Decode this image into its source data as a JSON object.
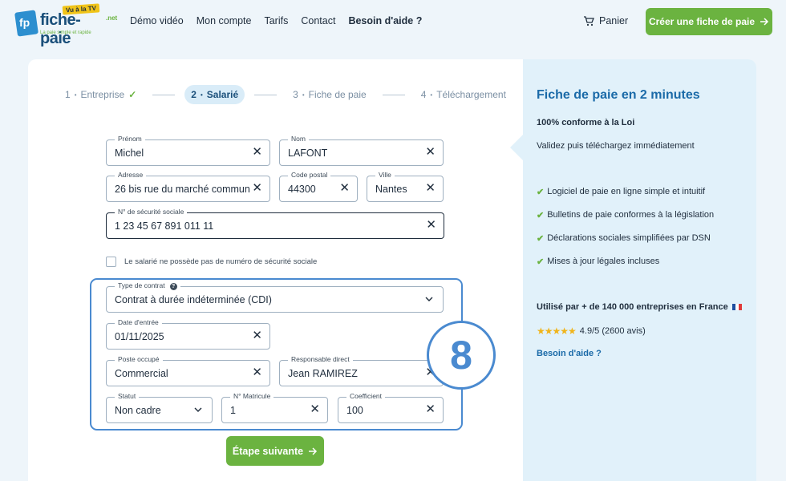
{
  "header": {
    "logo_tv": "Vu à la TV",
    "logo_fp": "fp",
    "logo_name": "fiche-paie",
    "logo_net": ".net",
    "logo_tagline": "La paie simple et rapide",
    "nav": [
      "Démo vidéo",
      "Mon compte",
      "Tarifs",
      "Contact",
      "Besoin d'aide ?"
    ],
    "cart_label": "Panier",
    "cta_label": "Créer une fiche de paie"
  },
  "steps": [
    {
      "num": "1",
      "label": "Entreprise"
    },
    {
      "num": "2",
      "label": "Salarié"
    },
    {
      "num": "3",
      "label": "Fiche de paie"
    },
    {
      "num": "4",
      "label": "Téléchargement"
    }
  ],
  "form": {
    "prenom": {
      "label": "Prénom",
      "value": "Michel"
    },
    "nom": {
      "label": "Nom",
      "value": "LAFONT"
    },
    "adresse": {
      "label": "Adresse",
      "value": "26 bis rue du marché commun"
    },
    "code_postal": {
      "label": "Code postal",
      "value": "44300"
    },
    "ville": {
      "label": "Ville",
      "value": "Nantes"
    },
    "secu": {
      "label": "N° de sécurité sociale",
      "value": "1 23 45 67 891 011 11"
    },
    "no_secu_label": "Le salarié ne possède pas de numéro de sécurité sociale",
    "contrat": {
      "label": "Type de contrat",
      "value": "Contrat à durée indéterminée (CDI)"
    },
    "date_entree": {
      "label": "Date d'entrée",
      "value": "01/11/2025"
    },
    "poste": {
      "label": "Poste occupé",
      "value": "Commercial"
    },
    "responsable": {
      "label": "Responsable direct",
      "value": "Jean RAMIREZ"
    },
    "statut": {
      "label": "Statut",
      "value": "Non cadre"
    },
    "matricule": {
      "label": "N° Matricule",
      "value": "1"
    },
    "coefficient": {
      "label": "Coefficient",
      "value": "100"
    },
    "badge": "8",
    "next_label": "Étape suivante"
  },
  "side": {
    "title": "Fiche de paie en 2 minutes",
    "subtitle": "100% conforme à la Loi",
    "text": "Validez puis téléchargez immédiatement",
    "features": [
      "Logiciel de paie en ligne simple et intuitif",
      "Bulletins de paie conformes à la législation",
      "Déclarations sociales simplifiées par DSN",
      "Mises à jour légales incluses"
    ],
    "used_by": "Utilisé par + de 140 000 entreprises en France",
    "stars": "★★★★★",
    "rating": "4.9/5 (2600 avis)",
    "help_link": "Besoin d'aide ?"
  },
  "colors": {
    "accent_green": "#6bb340",
    "accent_blue": "#4a8ad0",
    "side_bg": "#e1f1fa"
  }
}
